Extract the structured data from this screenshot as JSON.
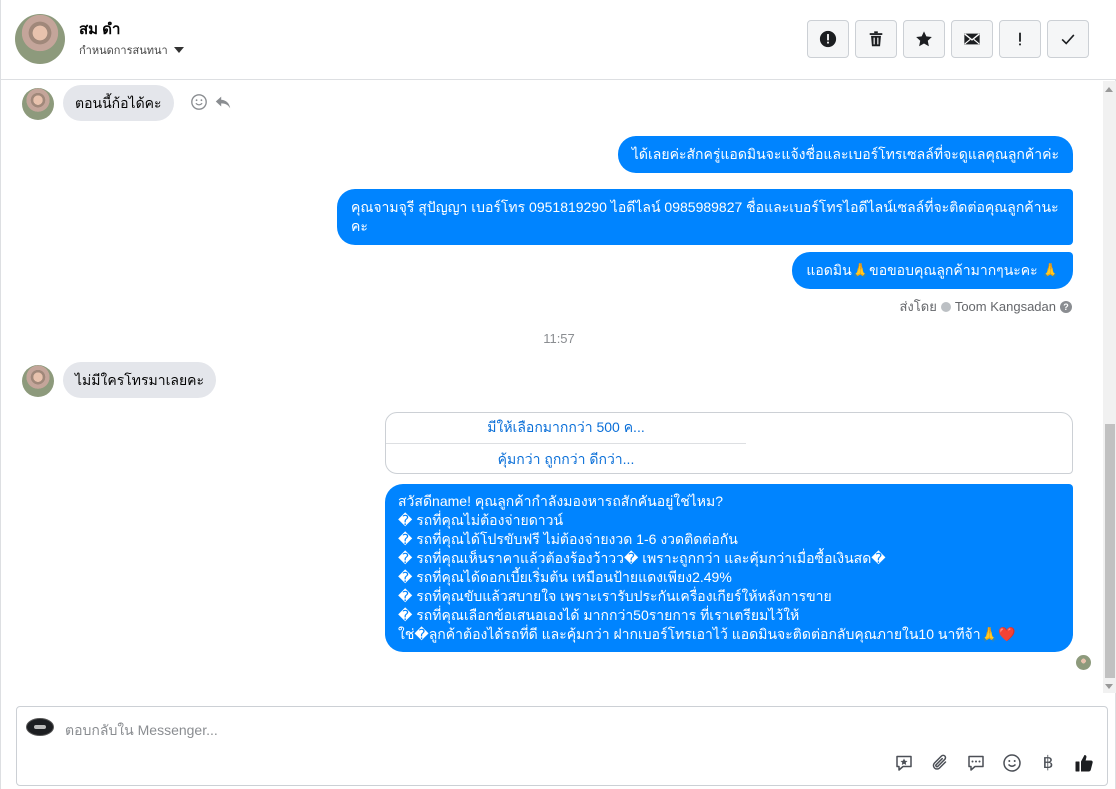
{
  "header": {
    "contact_name": "สม ดำ",
    "assign_label": "กำหนดการสนทนา"
  },
  "toolbar": {
    "buttons": [
      "alert-circle-icon",
      "trash-icon",
      "star-icon",
      "mail-icon",
      "exclamation-icon",
      "check-icon"
    ]
  },
  "messages": {
    "incoming_1": "ตอนนี้ก้อได้คะ",
    "outgoing_1": "ได้เลยค่ะสักครู่แอดมินจะแจ้งชื่อและเบอร์โทรเซลล์ที่จะดูแลคุณลูกค้าค่ะ",
    "outgoing_2": "คุณจามจุรี สุปัญญา เบอร์โทร 0951819290  ไอดีไลน์ 0985989827 ชื่อและเบอร์โทรไอดีไลน์เซลล์ที่จะติดต่อคุณลูกค้านะคะ",
    "outgoing_3": "แอดมิน🙏ขอขอบคุณลูกค้ามากๆนะคะ 🙏",
    "sent_by_label": "ส่งโดย",
    "sent_by_name": "Toom Kangsadan",
    "timestamp": "11:57",
    "incoming_2": "ไม่มีใครโทรมาเลยคะ",
    "option_1": "มีให้เลือกมากกว่า 500 ค...",
    "option_2": "คุ้มกว่า ถูกกว่า ดีกว่า...",
    "promo_lines": [
      "สวัสดีname! คุณลูกค้ากำลังมองหารถสักคันอยู่ใช่ไหม?",
      "� รถที่คุณไม่ต้องจ่ายดาวน์",
      "� รถที่คุณได้โปรขับฟรี ไม่ต้องจ่ายงวด 1-6 งวดติดต่อกัน",
      "� รถที่คุณเห็นราคาแล้วต้องร้องว้าวว� เพราะถูกกว่า และคุ้มกว่าเมื่อซื้อเงินสด�",
      "� รถที่คุณได้ดอกเบี้ยเริ่มต้น เหมือนป้ายแดงเพียง2.49%",
      "� รถที่คุณขับแล้วสบายใจ เพราะเรารับประกันเครื่องเกียร์ให้หลังการขาย",
      "� รถที่คุณเลือกข้อเสนอเองได้ มากกว่า50รายการ ที่เราเตรียมไว้ให้",
      "ใช่�ลูกค้าต้องได้รถที่ดี และคุ้มกว่า ฝากเบอร์โทรเอาไว้ แอดมินจะติดต่อกลับคุณภายใน10 นาทีจ้า🙏❤️"
    ]
  },
  "composer": {
    "placeholder": "ตอบกลับใน Messenger...",
    "icons": [
      "saved-reply-icon",
      "attachment-icon",
      "chat-bubble-icon",
      "emoji-icon",
      "baht-icon",
      "thumbs-up-icon"
    ],
    "baht_symbol": "฿"
  },
  "colors": {
    "accent": "#0084ff",
    "incoming_bubble": "#e4e6eb",
    "link": "#0a6fd8"
  }
}
